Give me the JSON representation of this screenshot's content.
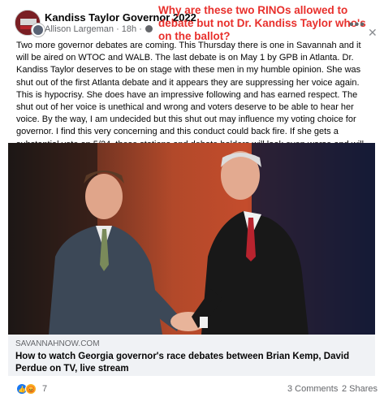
{
  "post": {
    "group_name": "Kandiss Taylor Governor 2022",
    "author": "Allison Largeman",
    "time": "18h",
    "separator": "·",
    "body": "Two more governor debates are coming.  This Thursday there is one in Savannah and it will be aired on WTOC and WALB.  The last debate is on May 1 by GPB in Atlanta.  Dr. Kandiss Taylor deserves to be on stage with these men in my humble opinion.  She was shut out of the first Atlanta debate and it appears they are suppressing her voice again.  This is hypocrisy. She does have an impressive following and has earned respect.  The shut out of her voice is unethical and wrong and voters deserve to be able to hear her voice.   By the way, I am undecided but this shut out may influence my voting choice for governor.  I find this very concerning and this conduct could back fire.  If she gets a substantial vote on 5/24, these stations and debate holders will look even worse and will lose  credibility.  Let Kandiss debate."
  },
  "overlay": {
    "text": "Why are these two RINOs allowed to debate but not Dr. Kandiss Taylor who's on the ballot?",
    "color": "#e8302c"
  },
  "link_preview": {
    "domain": "SAVANNAHNOW.COM",
    "title": "How to watch Georgia governor's race debates between Brian Kemp, David Perdue on TV, live stream"
  },
  "footer": {
    "reaction_count": "7",
    "comments": "3 Comments",
    "shares": "2 Shares"
  },
  "icons": {
    "more": "more-options-icon",
    "close": "close-icon",
    "info": "info-icon",
    "globe": "globe-icon",
    "reactions": [
      "like-reaction-icon",
      "angry-reaction-icon"
    ]
  },
  "colors": {
    "link_preview_bg": "#f0f2f5",
    "secondary_text": "#65676b",
    "like_blue": "#1877f2"
  }
}
